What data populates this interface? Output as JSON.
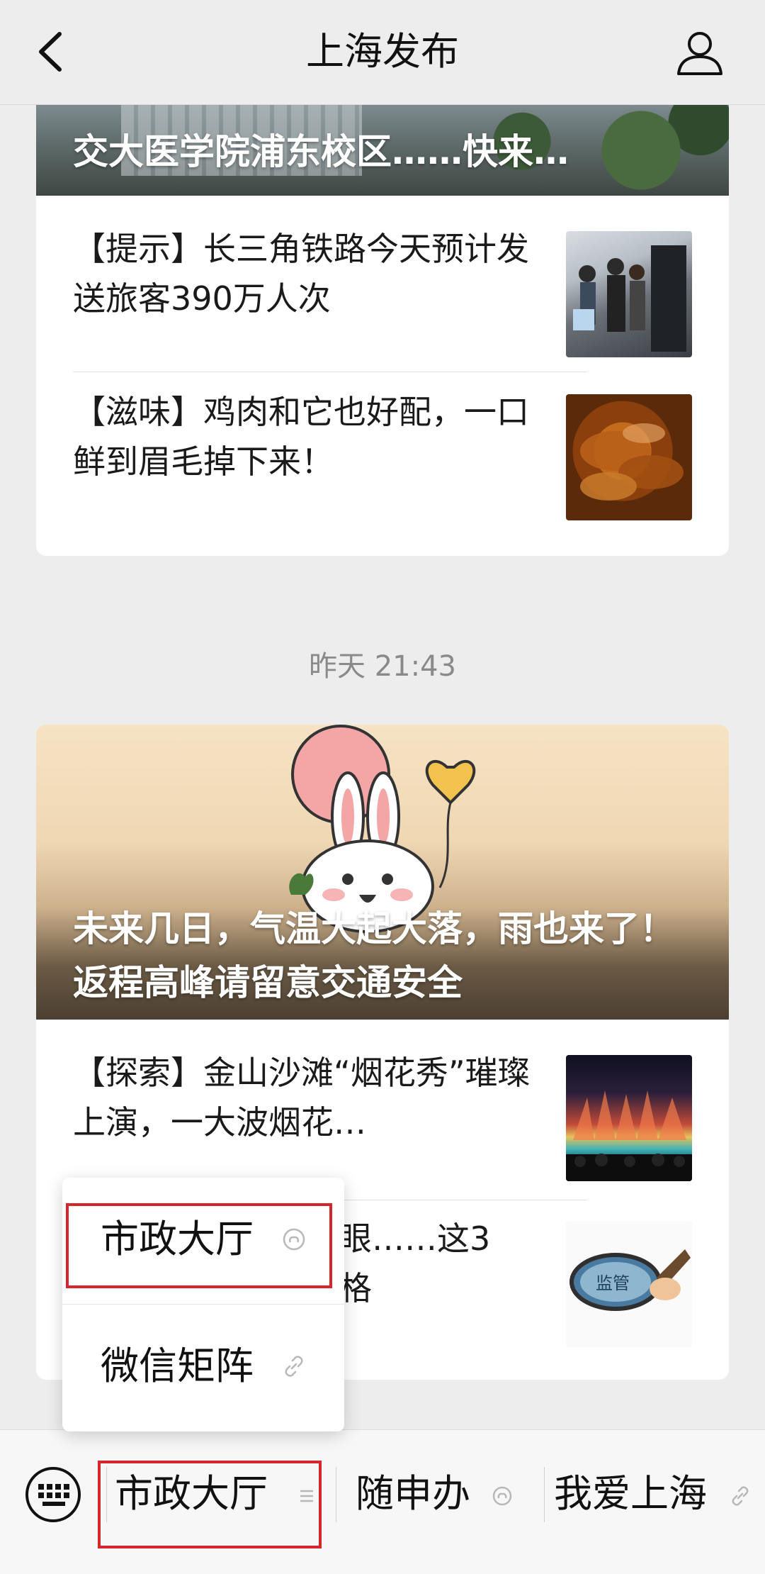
{
  "header": {
    "title": "上海发布"
  },
  "feed": {
    "card1": {
      "hero_title": "交大医学院浦东校区……快来…",
      "items": [
        {
          "text": "【提示】长三角铁路今天预计发送旅客390万人次",
          "thumb": "railway-station-photo"
        },
        {
          "text": "【滋味】鸡肉和它也好配，一口鲜到眉毛掉下来！",
          "thumb": "braised-chicken-photo"
        }
      ]
    },
    "timestamp": "昨天 21:43",
    "card2": {
      "hero_title": "未来几日，气温大起大落，雨也来了！返程高峰请留意交通安全",
      "hero_art": "bunny-balloon-illustration",
      "items": [
        {
          "text": "【探索】金山沙滩“烟花秀”璀璨上演，一大波烟花…",
          "thumb": "fireworks-show-photo"
        },
        {
          "text_tail_1": "亮眼……这3",
          "text_tail_2": "合格",
          "thumb_label": "监管",
          "thumb": "magnifier-supervision-illustration"
        }
      ]
    }
  },
  "popup_menu": {
    "items": [
      {
        "label": "市政大厅",
        "icon": "mini-program-icon"
      },
      {
        "label": "微信矩阵",
        "icon": "link-icon"
      }
    ]
  },
  "menu_bar": {
    "keyboard_icon": "keyboard-icon",
    "items": [
      {
        "label": "市政大厅",
        "icon": "submenu-icon"
      },
      {
        "label": "随申办",
        "icon": "mini-program-icon"
      },
      {
        "label": "我爱上海",
        "icon": "link-icon"
      }
    ]
  },
  "colors": {
    "background": "#ededed",
    "card": "#ffffff",
    "highlight": "#d6262d",
    "timestamp": "#8a8a8a"
  }
}
